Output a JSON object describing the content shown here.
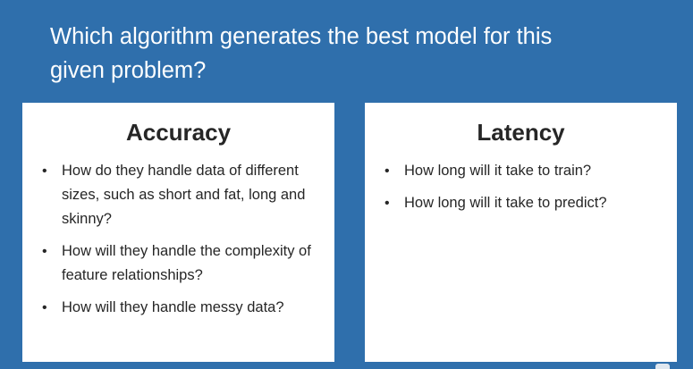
{
  "question": {
    "line1": "Which algorithm generates the best model for this",
    "line2": "given problem?"
  },
  "cards": {
    "accuracy": {
      "title": "Accuracy",
      "items": [
        "How do they handle data of different sizes, such as short and fat, long and skinny?",
        "How will they handle the complexity of feature relationships?",
        "How will they handle messy data?"
      ]
    },
    "latency": {
      "title": "Latency",
      "items": [
        "How long will it take to train?",
        "How long will it take to predict?"
      ]
    }
  },
  "bullet_glyph": "•"
}
